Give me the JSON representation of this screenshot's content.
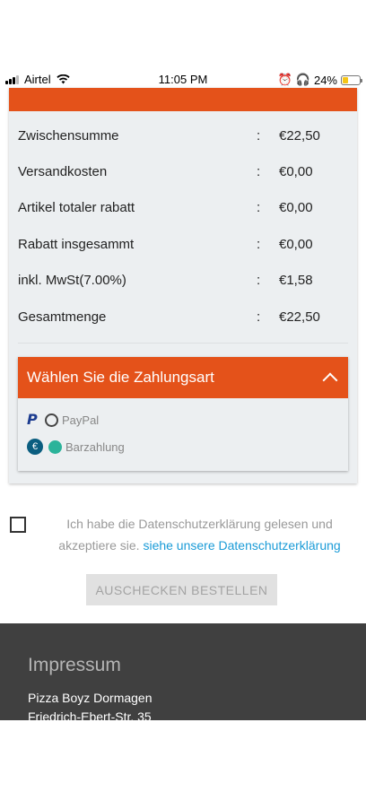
{
  "status_bar": {
    "carrier": "Airtel",
    "time": "11:05 PM",
    "battery": "24%"
  },
  "summary": [
    {
      "label": "Zwischensumme",
      "colon": ":",
      "value": "€22,50"
    },
    {
      "label": "Versandkosten",
      "colon": ":",
      "value": "€0,00"
    },
    {
      "label": "Artikel totaler rabatt",
      "colon": ":",
      "value": "€0,00"
    },
    {
      "label": "Rabatt insgesammt",
      "colon": ":",
      "value": "€0,00"
    },
    {
      "label": "inkl. MwSt(7.00%)",
      "colon": ":",
      "value": "€1,58"
    },
    {
      "label": "Gesamtmenge",
      "colon": ":",
      "value": "€22,50"
    }
  ],
  "payment": {
    "title": "Wählen Sie die Zahlungsart",
    "options": [
      {
        "label": "PayPal",
        "selected": false,
        "icon": "paypal-icon"
      },
      {
        "label": "Barzahlung",
        "selected": true,
        "icon": "cash-icon"
      }
    ]
  },
  "consent": {
    "text": "Ich habe die Datenschutzerklärung gelesen und akzeptiere sie.",
    "link": "siehe unsere Datenschutzerklärung",
    "checked": false
  },
  "checkout_button": "AUSCHECKEN BESTELLEN",
  "footer": {
    "title": "Impressum",
    "lines": [
      "Pizza Boyz Dormagen",
      "Friedrich-Ebert-Str. 35"
    ]
  },
  "colors": {
    "accent": "#e4521a",
    "selected_radio": "#2bb39a",
    "link": "#1a9bd7",
    "footer_bg": "#404040"
  }
}
